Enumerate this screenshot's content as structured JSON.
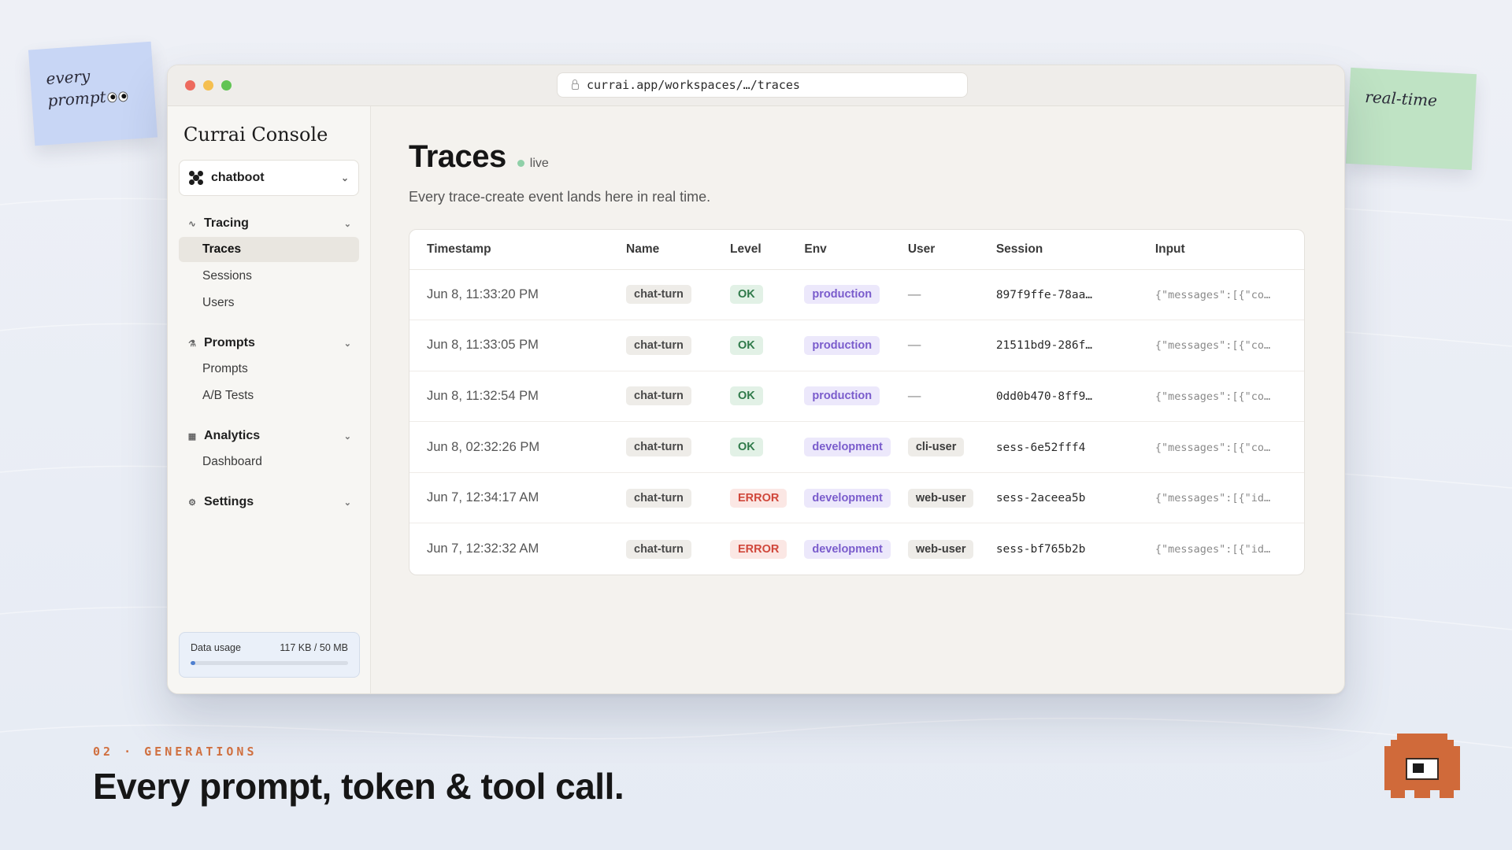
{
  "sticky_notes": {
    "left_line1": "every",
    "left_line2": "prompt",
    "right": "real-time"
  },
  "browser": {
    "url": "currai.app/workspaces/…/traces"
  },
  "sidebar": {
    "brand": "Currai Console",
    "project": "chatboot",
    "groups": [
      {
        "label": "Tracing",
        "icon": "tracing-icon",
        "items": [
          "Traces",
          "Sessions",
          "Users"
        ]
      },
      {
        "label": "Prompts",
        "icon": "flask-icon",
        "items": [
          "Prompts",
          "A/B Tests"
        ]
      },
      {
        "label": "Analytics",
        "icon": "grid-icon",
        "items": [
          "Dashboard"
        ]
      },
      {
        "label": "Settings",
        "icon": "gear-icon",
        "items": []
      }
    ],
    "active_item": "Traces",
    "usage": {
      "label": "Data usage",
      "value": "117 KB / 50 MB",
      "fraction": 0.03
    }
  },
  "main": {
    "title": "Traces",
    "live_label": "live",
    "subtitle": "Every trace-create event lands here in real time.",
    "columns": [
      "Timestamp",
      "Name",
      "Level",
      "Env",
      "User",
      "Session",
      "Input"
    ],
    "rows": [
      {
        "timestamp": "Jun 8, 11:33:20 PM",
        "name": "chat-turn",
        "level": "OK",
        "env": "production",
        "user": "—",
        "session": "897f9ffe-78aa…",
        "input": "{\"messages\":[{\"co…"
      },
      {
        "timestamp": "Jun 8, 11:33:05 PM",
        "name": "chat-turn",
        "level": "OK",
        "env": "production",
        "user": "—",
        "session": "21511bd9-286f…",
        "input": "{\"messages\":[{\"co…"
      },
      {
        "timestamp": "Jun 8, 11:32:54 PM",
        "name": "chat-turn",
        "level": "OK",
        "env": "production",
        "user": "—",
        "session": "0dd0b470-8ff9…",
        "input": "{\"messages\":[{\"co…"
      },
      {
        "timestamp": "Jun 8, 02:32:26 PM",
        "name": "chat-turn",
        "level": "OK",
        "env": "development",
        "user": "cli-user",
        "session": "sess-6e52fff4",
        "input": "{\"messages\":[{\"co…"
      },
      {
        "timestamp": "Jun 7, 12:34:17 AM",
        "name": "chat-turn",
        "level": "ERROR",
        "env": "development",
        "user": "web-user",
        "session": "sess-2aceea5b",
        "input": "{\"messages\":[{\"id…"
      },
      {
        "timestamp": "Jun 7, 12:32:32 AM",
        "name": "chat-turn",
        "level": "ERROR",
        "env": "development",
        "user": "web-user",
        "session": "sess-bf765b2b",
        "input": "{\"messages\":[{\"id…"
      }
    ]
  },
  "slide": {
    "kicker": "02 · GENERATIONS",
    "headline": "Every prompt, token & tool call."
  },
  "colors": {
    "accent_orange": "#d07040",
    "ok": "#2f7a4a",
    "error": "#d0473b",
    "env": "#7a5ccc"
  }
}
